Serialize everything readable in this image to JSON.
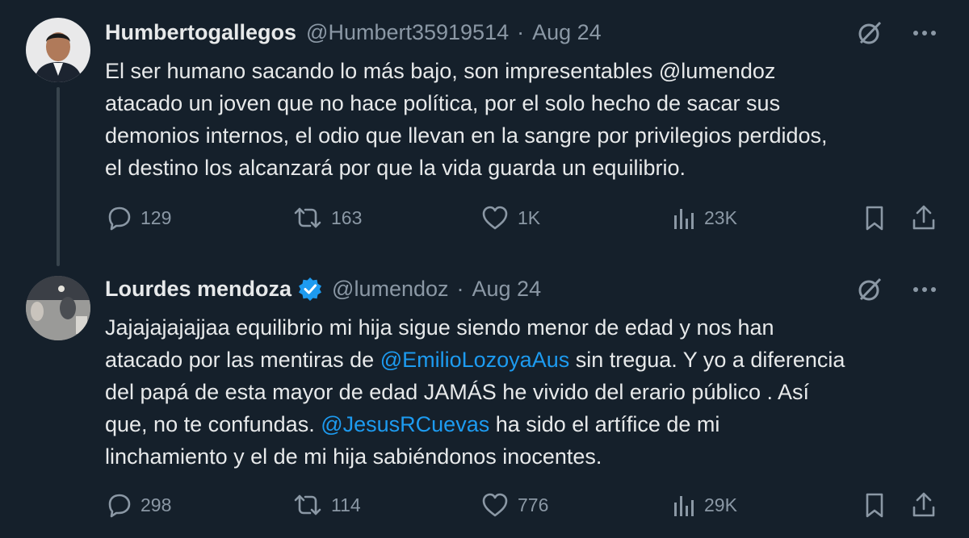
{
  "tweets": [
    {
      "author_name": "Humbertogallegos",
      "handle": "@Humbert35919514",
      "separator": "·",
      "date": "Aug 24",
      "verified": false,
      "lines": [
        [
          {
            "text": "El ser  humano sacando lo más bajo, son impresentables @lumendoz",
            "mention": false
          }
        ],
        [
          {
            "text": "atacado un joven que no hace política, por el solo hecho de sacar sus",
            "mention": false
          }
        ],
        [
          {
            "text": "demonios internos, el odio que llevan en la sangre por privilegios perdidos,",
            "mention": false
          }
        ],
        [
          {
            "text": "el destino los alcanzará por que la vida guarda un equilibrio.",
            "mention": false
          }
        ]
      ],
      "stats": {
        "replies": "129",
        "reposts": "163",
        "likes": "1K",
        "views": "23K"
      }
    },
    {
      "author_name": "Lourdes mendoza",
      "handle": "@lumendoz",
      "separator": "·",
      "date": "Aug 24",
      "verified": true,
      "lines": [
        [
          {
            "text": "Jajajajajajjaa equilibrio mi hija sigue siendo menor de edad y nos han",
            "mention": false
          }
        ],
        [
          {
            "text": "atacado por las mentiras de ",
            "mention": false
          },
          {
            "text": "@EmilioLozoyaAus",
            "mention": true
          },
          {
            "text": " sin tregua. Y yo a diferencia",
            "mention": false
          }
        ],
        [
          {
            "text": "del papá de esta mayor de edad JAMÁS he vivido del erario público . Así",
            "mention": false
          }
        ],
        [
          {
            "text": "que, no te confundas. ",
            "mention": false
          },
          {
            "text": "@JesusRCuevas",
            "mention": true
          },
          {
            "text": " ha sido el artífice de mi",
            "mention": false
          }
        ],
        [
          {
            "text": "linchamiento y el de mi hija sabiéndonos inocentes.",
            "mention": false
          }
        ]
      ],
      "stats": {
        "replies": "298",
        "reposts": "114",
        "likes": "776",
        "views": "29K"
      }
    }
  ],
  "colors": {
    "background": "#15202b",
    "text": "#e7e9ea",
    "secondary": "#8b98a5",
    "accent": "#1d9bf0",
    "thread_line": "#38444d"
  },
  "icons": {
    "reply": "speech-bubble-icon",
    "repost": "repost-arrows-icon",
    "like": "heart-icon",
    "views": "bar-chart-icon",
    "bookmark": "bookmark-icon",
    "share": "share-upload-icon",
    "grok": "slashed-circle-icon",
    "more": "more-dots-icon",
    "verified": "verified-badge-icon"
  }
}
